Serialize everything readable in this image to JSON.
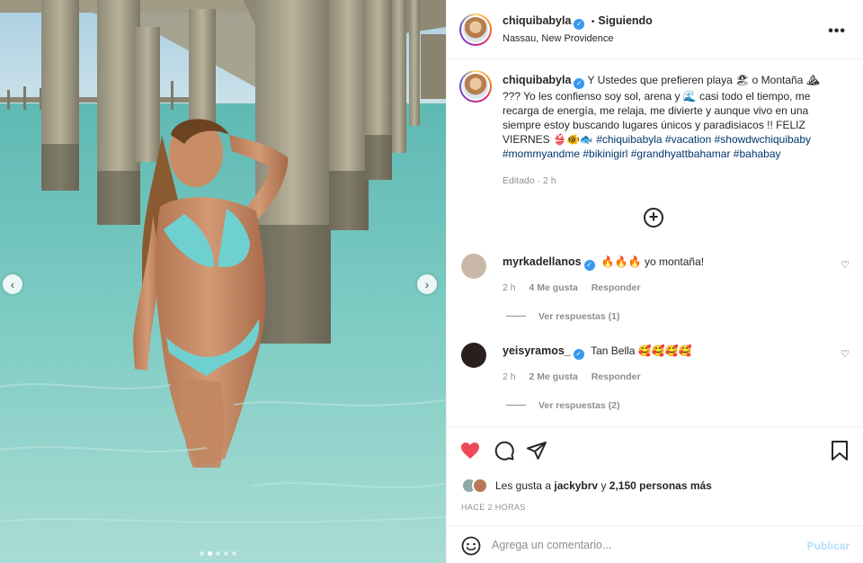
{
  "post": {
    "username": "chiquibabyla",
    "verified_mark": "✓",
    "separator": "•",
    "follow_status": "Siguiendo",
    "location": "Nassau, New Providence",
    "more_icon": "•••"
  },
  "caption": {
    "username": "chiquibabyla",
    "part1": "Y Ustedes que prefieren playa 🏖 o Montaña ⛰ ??? Yo les confienso soy sol, arena y 🌊 casi todo el tiempo, me recarga de energía, me relaja, me divierte y aunque vivo en una siempre estoy buscando lugares únicos y paradisiacos !! FELIZ VIERNES 👙🐠🐟",
    "hashtags": "#chiquibabyla #vacation #showdwchiquibaby #mommyandme #bikinigirl #grandhyattbahamar #bahabay",
    "edited": "Editado · 2 h"
  },
  "comments": [
    {
      "username": "myrkadellanos",
      "text": "🔥🔥🔥 yo montaña!",
      "time": "2 h",
      "likes": "4 Me gusta",
      "reply": "Responder",
      "view_replies": "Ver respuestas (1)",
      "avatar_color": "#c9b8a8"
    },
    {
      "username": "yeisyramos_",
      "text": "Tan Bella 🥰🥰🥰🥰",
      "time": "2 h",
      "likes": "2 Me gusta",
      "reply": "Responder",
      "view_replies": "Ver respuestas (2)",
      "avatar_color": "#2a1e1e"
    }
  ],
  "likes": {
    "prefix": "Les gusta a",
    "user": "jackybrv",
    "middle": "y",
    "count": "2,150 personas más"
  },
  "time_ago": "HACE 2 HORAS",
  "add_comment": {
    "placeholder": "Agrega un comentario...",
    "publish": "Publicar"
  },
  "carousel": {
    "total": 5,
    "active_index": 1,
    "prev": "‹",
    "next": "›"
  },
  "colors": {
    "heart": "#ed4956",
    "link": "#00376b",
    "verified": "#3897f0",
    "publish_disabled": "#b2dffc"
  }
}
